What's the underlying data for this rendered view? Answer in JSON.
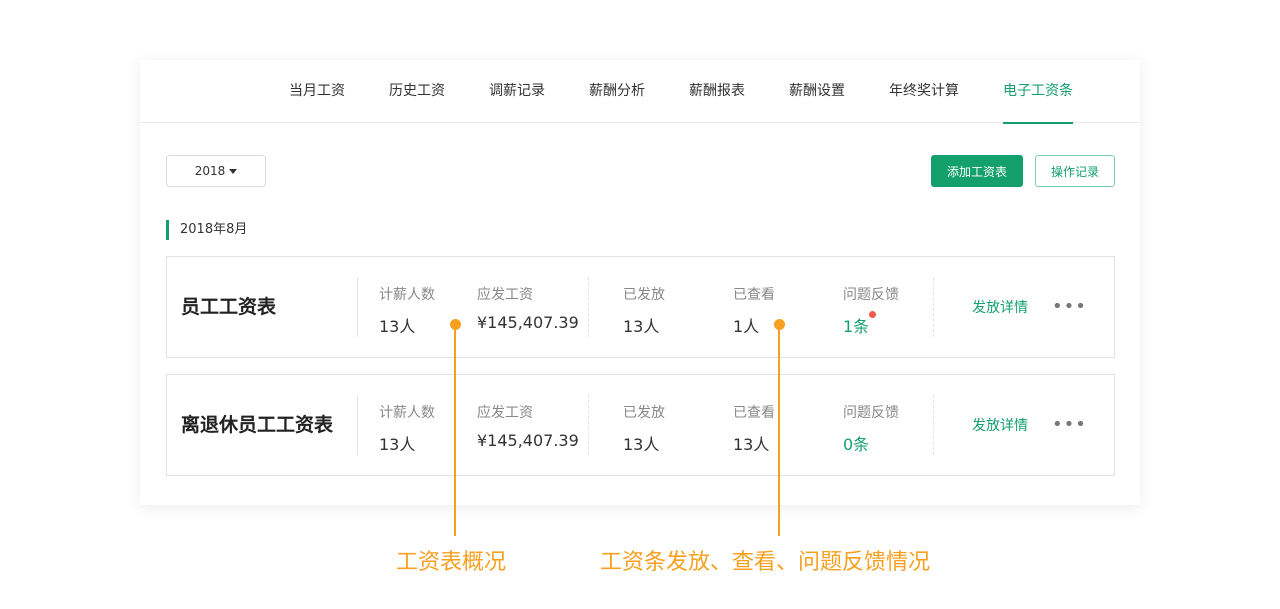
{
  "tabs": [
    {
      "label": "当月工资"
    },
    {
      "label": "历史工资"
    },
    {
      "label": "调薪记录"
    },
    {
      "label": "薪酬分析"
    },
    {
      "label": "薪酬报表"
    },
    {
      "label": "薪酬设置"
    },
    {
      "label": "年终奖计算"
    },
    {
      "label": "电子工资条",
      "active": true
    }
  ],
  "toolbar": {
    "year_value": "2018",
    "add_button": "添加工资表",
    "log_button": "操作记录"
  },
  "month_label": "2018年8月",
  "sheets": [
    {
      "title": "员工工资表",
      "stats": {
        "headcount_label": "计薪人数",
        "headcount": "13人",
        "payable_label": "应发工资",
        "payable": "¥145,407.39",
        "issued_label": "已发放",
        "issued": "13人",
        "viewed_label": "已查看",
        "viewed": "1人",
        "feedback_label": "问题反馈",
        "feedback": "1条"
      },
      "detail_link": "发放详情",
      "more": "•••"
    },
    {
      "title": "离退休员工工资表",
      "stats": {
        "headcount_label": "计薪人数",
        "headcount": "13人",
        "payable_label": "应发工资",
        "payable": "¥145,407.39",
        "issued_label": "已发放",
        "issued": "13人",
        "viewed_label": "已查看",
        "viewed": "13人",
        "feedback_label": "问题反馈",
        "feedback": "0条"
      },
      "detail_link": "发放详情",
      "more": "•••"
    }
  ],
  "annotations": {
    "left": "工资表概况",
    "right": "工资条发放、查看、问题反馈情况"
  },
  "colors": {
    "accent": "#13a06d",
    "annotation": "#f7a020",
    "alert_dot": "#f25a4a"
  }
}
